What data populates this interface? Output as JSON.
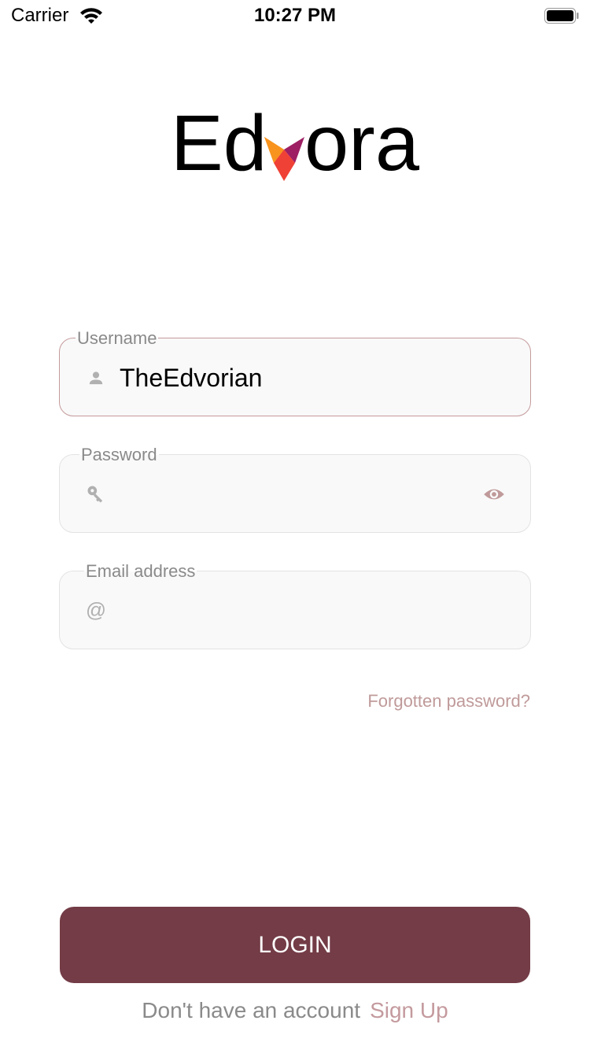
{
  "status_bar": {
    "carrier": "Carrier",
    "time": "10:27 PM"
  },
  "logo": {
    "text": "Edvora",
    "colors": [
      "#f7931e",
      "#9e1f63",
      "#ef4136"
    ]
  },
  "form": {
    "username": {
      "label": "Username",
      "value": "TheEdvorian",
      "icon": "person-icon"
    },
    "password": {
      "label": "Password",
      "value": "",
      "icon": "key-icon",
      "toggle_icon": "eye-icon"
    },
    "email": {
      "label": "Email address",
      "value": "",
      "icon": "at-icon"
    }
  },
  "forgot_password": "Forgotten password?",
  "login_button": "LOGIN",
  "signup": {
    "prompt": "Don't have an account",
    "link": "Sign Up"
  },
  "colors": {
    "primary": "#733c46",
    "accent": "#c49a9e"
  }
}
